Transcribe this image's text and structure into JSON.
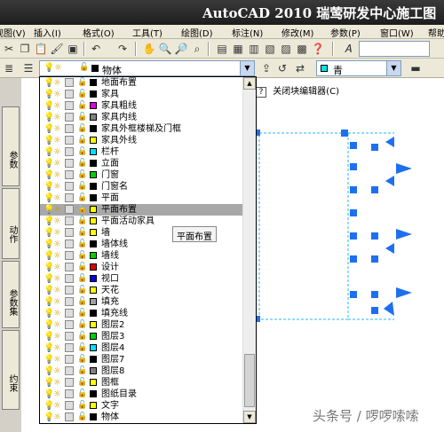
{
  "window": {
    "title": "AutoCAD 2010  瑞莺研发中心施工图"
  },
  "menu": [
    {
      "id": "view",
      "label": "视图(V)"
    },
    {
      "id": "insert",
      "label": "插入(I)"
    },
    {
      "id": "format",
      "label": "格式(O)"
    },
    {
      "id": "tools",
      "label": "工具(T)"
    },
    {
      "id": "draw",
      "label": "绘图(D)"
    },
    {
      "id": "dimension",
      "label": "标注(N)"
    },
    {
      "id": "modify",
      "label": "修改(M)"
    },
    {
      "id": "parameter",
      "label": "参数(P)"
    },
    {
      "id": "window",
      "label": "窗口(W)"
    },
    {
      "id": "help",
      "label": "帮助"
    }
  ],
  "layer_combo": {
    "current": "物体"
  },
  "color_combo": {
    "current": "青",
    "swatch": "#00e5ee"
  },
  "block_editor": {
    "help": "?",
    "label": "关闭块编辑器(C)"
  },
  "palette_tabs": [
    "参数",
    "动作",
    "参数集",
    "约束"
  ],
  "layers": [
    {
      "name": "地面布置",
      "color": "#000000"
    },
    {
      "name": "家具",
      "color": "#000000"
    },
    {
      "name": "家具粗线",
      "color": "#e000e0"
    },
    {
      "name": "家具内线",
      "color": "#808080"
    },
    {
      "name": "家具外框楼梯及门框",
      "color": "#000000"
    },
    {
      "name": "家具外线",
      "color": "#ffff00"
    },
    {
      "name": "栏杆",
      "color": "#00e0ff"
    },
    {
      "name": "立面",
      "color": "#000000"
    },
    {
      "name": "门窗",
      "color": "#00d000"
    },
    {
      "name": "门窗名",
      "color": "#000000"
    },
    {
      "name": "平面",
      "color": "#000000"
    },
    {
      "name": "平面布置",
      "color": "#ffff00"
    },
    {
      "name": "平面活动家具",
      "color": "#ffff00"
    },
    {
      "name": "墙",
      "color": "#ffff00"
    },
    {
      "name": "墙体线",
      "color": "#000000"
    },
    {
      "name": "墙线",
      "color": "#00d000"
    },
    {
      "name": "设计",
      "color": "#e00000"
    },
    {
      "name": "视口",
      "color": "#0000e0"
    },
    {
      "name": "天花",
      "color": "#ffff00"
    },
    {
      "name": "填充",
      "color": "#a0a0a0"
    },
    {
      "name": "填充线",
      "color": "#000000"
    },
    {
      "name": "图层2",
      "color": "#ffff00"
    },
    {
      "name": "图层3",
      "color": "#00d000"
    },
    {
      "name": "图层4",
      "color": "#00e0ff"
    },
    {
      "name": "图层7",
      "color": "#000000"
    },
    {
      "name": "图层8",
      "color": "#808080"
    },
    {
      "name": "图框",
      "color": "#ffff00"
    },
    {
      "name": "图纸目录",
      "color": "#000000"
    },
    {
      "name": "文字",
      "color": "#ffff00"
    },
    {
      "name": "物体",
      "color": "#000000"
    }
  ],
  "selected_layer_index": 11,
  "tooltip": "平面布置",
  "watermark": "头条号 / 啰啰嗦嗦",
  "colors": {
    "cad_accent": "#1e6ff0",
    "cad_dash": "#29b6f6"
  }
}
